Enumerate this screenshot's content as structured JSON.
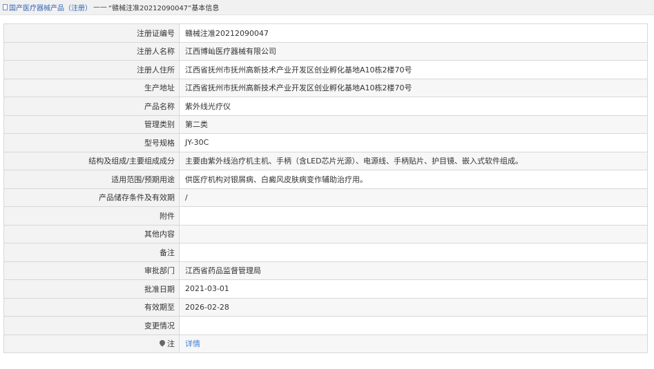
{
  "breadcrumb": {
    "section": "国产医疗器械产品（注册）",
    "separator": "——",
    "current": "“赣械注准20212090047”基本信息"
  },
  "rows": [
    {
      "label": "注册证编号",
      "value": "赣械注准20212090047"
    },
    {
      "label": "注册人名称",
      "value": "江西博屾医疗器械有限公司"
    },
    {
      "label": "注册人住所",
      "value": "江西省抚州市抚州高新技术产业开发区创业孵化基地A10栋2楼70号"
    },
    {
      "label": "生产地址",
      "value": "江西省抚州市抚州高新技术产业开发区创业孵化基地A10栋2楼70号"
    },
    {
      "label": "产品名称",
      "value": "紫外线光疗仪"
    },
    {
      "label": "管理类别",
      "value": "第二类"
    },
    {
      "label": "型号规格",
      "value": "JY-30C"
    },
    {
      "label": "结构及组成/主要组成成分",
      "value": "主要由紫外线治疗机主机、手柄（含LED芯片光源）、电源线、手柄贴片、护目镜、嵌入式软件组成。"
    },
    {
      "label": "适用范围/预期用途",
      "value": "供医疗机构对银屑病、白癜风皮肤病变作辅助治疗用。"
    },
    {
      "label": "产品储存条件及有效期",
      "value": "/"
    },
    {
      "label": "附件",
      "value": ""
    },
    {
      "label": "其他内容",
      "value": ""
    },
    {
      "label": "备注",
      "value": ""
    },
    {
      "label": "审批部门",
      "value": "江西省药品监督管理局"
    },
    {
      "label": "批准日期",
      "value": "2021-03-01"
    },
    {
      "label": "有效期至",
      "value": "2026-02-28"
    },
    {
      "label": "变更情况",
      "value": ""
    }
  ],
  "note": {
    "label": "注",
    "icon": "pin-icon",
    "link": "详情"
  },
  "colors": {
    "link": "#3f7fd1",
    "label_bg": "#f3f3f3",
    "border": "#d7d7d7"
  }
}
